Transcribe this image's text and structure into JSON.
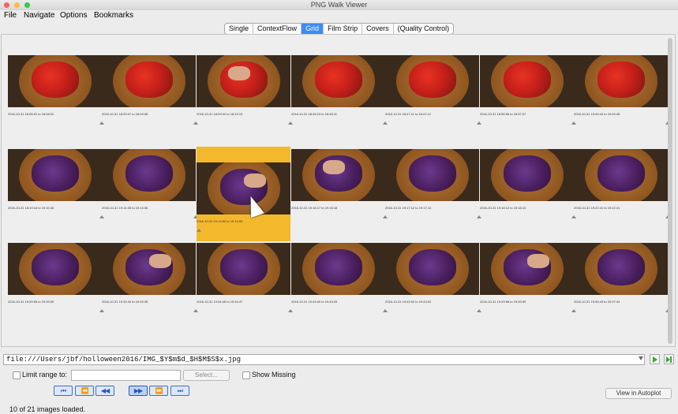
{
  "window": {
    "title": "PNG Walk Viewer"
  },
  "colors": {
    "selection": "#f4b82c",
    "tab_active": "#3b8cf5",
    "close": "#fc605b",
    "minimize": "#fdbc40",
    "zoom": "#34c84a"
  },
  "menu": [
    "File",
    "Navigate",
    "Options",
    "Bookmarks"
  ],
  "tabs": [
    {
      "label": "Single"
    },
    {
      "label": "ContextFlow"
    },
    {
      "label": "Grid",
      "active": true
    },
    {
      "label": "Film Strip"
    },
    {
      "label": "Covers"
    },
    {
      "label": "(Quality Control)"
    }
  ],
  "grid": {
    "selected_index": 9,
    "images": [
      {
        "caption": "2016-10-31 18:08:01 to 18:08:02",
        "tint": "red"
      },
      {
        "caption": "2016-10-31 18:09:07 to 18:09:08",
        "tint": "red"
      },
      {
        "caption": "2016-10-31 18:09:02 to 18:19:13",
        "tint": "red"
      },
      {
        "caption": "2016-10-31 18:45:13 to 18:45:11",
        "tint": "red"
      },
      {
        "caption": "2016-10-31 18:47:11 to 18:47:12",
        "tint": "red"
      },
      {
        "caption": "2016-10-31 18:56:06 to 18:57:07",
        "tint": "red"
      },
      {
        "caption": "2016-10-31 19:09:44 to 19:09:45",
        "tint": "red"
      },
      {
        "caption": "2016-10-31 18:19:44 to 19:10:45",
        "tint": "purple"
      },
      {
        "caption": "2016-10-31 19:14:35 to 19:14:36",
        "tint": "purple"
      },
      {
        "caption": "2016-10-31 19:14:52 to 19:14:53",
        "tint": "purple"
      },
      {
        "caption": "2016-10-31 19:16:17 to 19:16:18",
        "tint": "purple"
      },
      {
        "caption": "2016-10-31 19:17:12 to 19:17:13",
        "tint": "purple"
      },
      {
        "caption": "2016-10-31 19:18:12 to 19:18:13",
        "tint": "purple"
      },
      {
        "caption": "2016-10-31 19:22:41 to 19:22:41",
        "tint": "purple"
      },
      {
        "caption": "2016-10-31 19:39:05 to 19:39:05",
        "tint": "purple"
      },
      {
        "caption": "2016-10-31 19:33:34 to 19:33:35",
        "tint": "purple"
      },
      {
        "caption": "2016-10-31 19:34:46 to 19:34:47",
        "tint": "purple"
      },
      {
        "caption": "2016-10-31 19:43:00 to 19:43:03",
        "tint": "purple"
      },
      {
        "caption": "2016-10-31 19:43:02 to 19:43:02",
        "tint": "purple"
      },
      {
        "caption": "2016-10-31 19:49:58 to 19:49:59",
        "tint": "purple"
      },
      {
        "caption": "2016-10-31 19:55:43 to 20:07:44",
        "tint": "purple"
      }
    ]
  },
  "url": {
    "value": "file:///Users/jbf/holloween2016/IMG_$Y$m$d_$H$M$S$x.jpg"
  },
  "controls": {
    "limit_range_label": "Limit range to:",
    "select_button": "Select...",
    "show_missing_label": "Show Missing",
    "view_in_autoplot": "View in Autoplot"
  },
  "nav_buttons": [
    {
      "glyph": "⏮",
      "name": "first-page-button"
    },
    {
      "glyph": "⏪",
      "name": "prev-page-button"
    },
    {
      "glyph": "◀◀",
      "name": "prev-button"
    },
    {
      "glyph": "▶▶",
      "name": "next-button"
    },
    {
      "glyph": "⏩",
      "name": "next-page-button"
    },
    {
      "glyph": "⏭",
      "name": "last-page-button"
    }
  ],
  "status": {
    "text": "10 of 21 images loaded."
  }
}
